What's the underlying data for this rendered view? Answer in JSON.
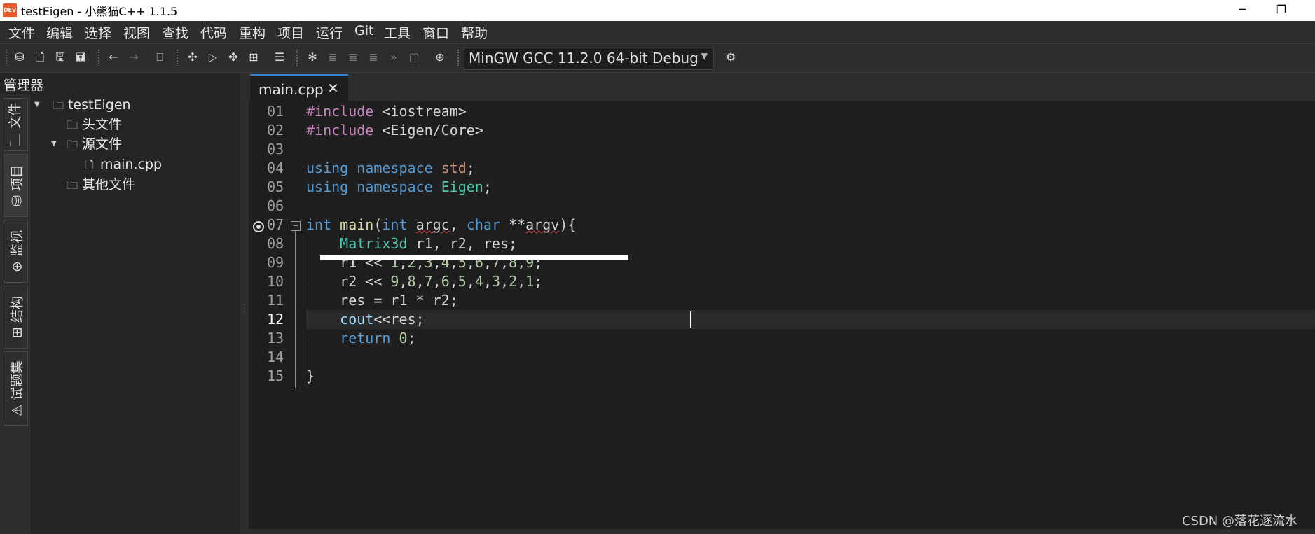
{
  "window": {
    "title": "testEigen - 小熊猫C++ 1.1.5",
    "icon_text": "DEV",
    "min_glyph": "─",
    "restore_glyph": "❐"
  },
  "menu": [
    "文件",
    "编辑",
    "选择",
    "视图",
    "查找",
    "代码",
    "重构",
    "项目",
    "运行",
    "Git",
    "工具",
    "窗口",
    "帮助"
  ],
  "toolbar": {
    "compiler": "MinGW GCC 11.2.0 64-bit Debug"
  },
  "side_panel": {
    "title": "管理器",
    "tabs": [
      "文件",
      "项目",
      "监视",
      "结构",
      "试题集"
    ],
    "tree": {
      "root": "testEigen",
      "headers": "头文件",
      "sources": "源文件",
      "main_file": "main.cpp",
      "others": "其他文件"
    }
  },
  "editor": {
    "tab_label": "main.cpp",
    "tab_close": "✕",
    "line_numbers": [
      "01",
      "02",
      "03",
      "04",
      "05",
      "06",
      "07",
      "08",
      "09",
      "10",
      "11",
      "12",
      "13",
      "14",
      "15"
    ],
    "current_line": 12
  },
  "colors": {
    "keyword": "#569cd6",
    "preprocessor": "#c586c0",
    "type": "#4ec9b0",
    "number": "#b5cea8",
    "background": "#1e1e1e"
  },
  "watermark": "CSDN @落花逐流水"
}
